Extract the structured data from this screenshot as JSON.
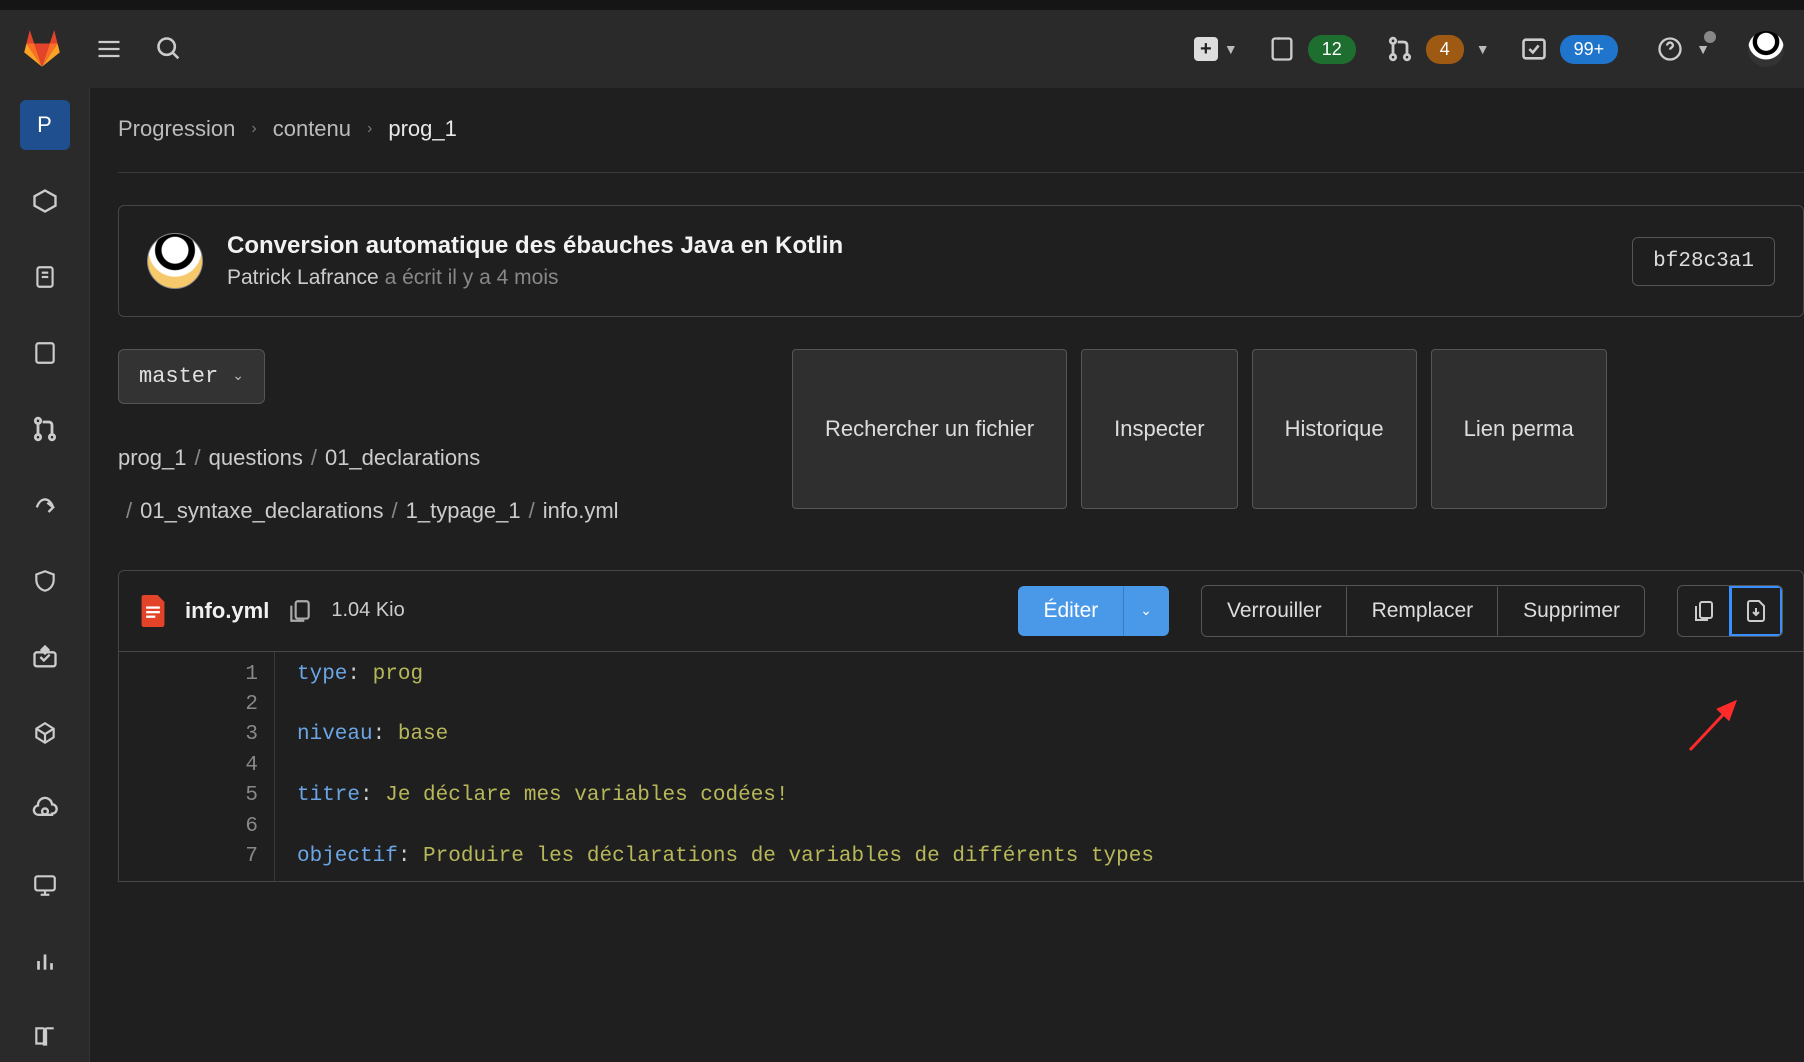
{
  "topbar": {
    "issues_count": "12",
    "mr_count": "4",
    "todos_count": "99+"
  },
  "sidebar": {
    "project_letter": "P"
  },
  "breadcrumb": {
    "root": "Progression",
    "mid": "contenu",
    "current": "prog_1"
  },
  "commit": {
    "title": "Conversion automatique des ébauches Java en Kotlin",
    "author": "Patrick Lafrance",
    "time": "a écrit il y a 4 mois",
    "sha": "bf28c3a1"
  },
  "branch": {
    "name": "master"
  },
  "path": {
    "segments": [
      "prog_1",
      "questions",
      "01_declarations",
      "01_syntaxe_declarations",
      "1_typage_1",
      "info.yml"
    ]
  },
  "buttons": {
    "find": "Rechercher un fichier",
    "blame": "Inspecter",
    "history": "Historique",
    "permalink": "Lien perma",
    "edit": "Éditer",
    "lock": "Verrouiller",
    "replace": "Remplacer",
    "delete": "Supprimer"
  },
  "file": {
    "name": "info.yml",
    "size": "1.04 Kio"
  },
  "code": {
    "lines": [
      {
        "n": "1",
        "key": "type",
        "punct": ": ",
        "val": "prog"
      },
      {
        "n": "2",
        "key": "",
        "punct": "",
        "val": ""
      },
      {
        "n": "3",
        "key": "niveau",
        "punct": ": ",
        "val": "base"
      },
      {
        "n": "4",
        "key": "",
        "punct": "",
        "val": ""
      },
      {
        "n": "5",
        "key": "titre",
        "punct": ": ",
        "val": "Je déclare mes variables codées!"
      },
      {
        "n": "6",
        "key": "",
        "punct": "",
        "val": ""
      },
      {
        "n": "7",
        "key": "objectif",
        "punct": ": ",
        "val": "Produire les déclarations de variables de différents types"
      }
    ]
  }
}
